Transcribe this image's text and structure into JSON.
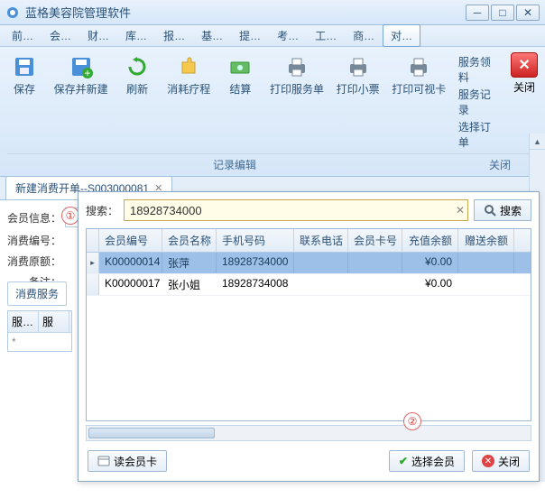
{
  "window": {
    "title": "蓝格美容院管理软件"
  },
  "menu": [
    "前…",
    "会…",
    "财…",
    "库…",
    "报…",
    "基…",
    "提…",
    "考…",
    "工…",
    "商…",
    "对…"
  ],
  "toolbar": {
    "buttons": [
      {
        "label": "保存"
      },
      {
        "label": "保存并新建"
      },
      {
        "label": "刷新"
      },
      {
        "label": "消耗疗程"
      },
      {
        "label": "结算"
      },
      {
        "label": "打印服务单"
      },
      {
        "label": "打印小票"
      },
      {
        "label": "打印可视卡"
      }
    ],
    "links": [
      "服务领料",
      "服务记录",
      "选择订单"
    ],
    "close": "关闭",
    "section_left": "记录编辑",
    "section_right": "关闭"
  },
  "tab": {
    "title": "新建消费开单--S003000081"
  },
  "form": {
    "member_info_label": "会员信息：",
    "consume_no_label": "消费编号：",
    "consume_origin_label": "消费原额：",
    "remark_label": "备注：",
    "annotation1": "①"
  },
  "side": {
    "tab_label": "消费服务",
    "col1": "服…",
    "col2": "服",
    "star": "*"
  },
  "popup": {
    "search_label": "搜索：",
    "search_value": "18928734000",
    "search_btn": "搜索",
    "columns": [
      "会员编号",
      "会员名称",
      "手机号码",
      "联系电话",
      "会员卡号",
      "充值余额",
      "赠送余额"
    ],
    "rows": [
      {
        "id": "K00000014",
        "name": "张萍",
        "phone": "18928734000",
        "contact": "",
        "card": "",
        "balance": "¥0.00",
        "gift": ""
      },
      {
        "id": "K00000017",
        "name": "张小姐",
        "phone": "18928734008",
        "contact": "",
        "card": "",
        "balance": "¥0.00",
        "gift": ""
      }
    ],
    "annotation2": "②",
    "read_card_btn": "读会员卡",
    "select_btn": "选择会员",
    "close_btn": "关闭"
  }
}
